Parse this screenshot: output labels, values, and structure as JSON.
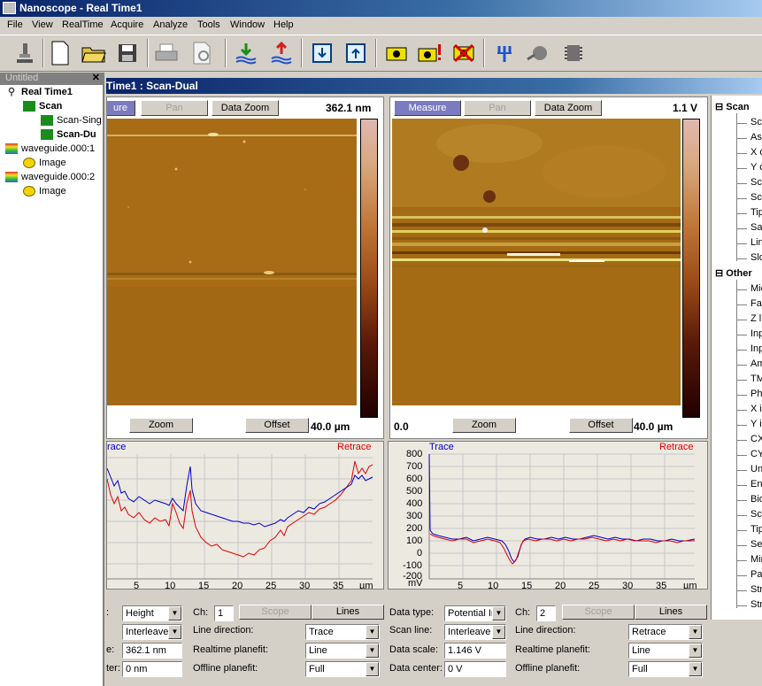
{
  "app": {
    "title": "Nanoscope - Real Time1"
  },
  "menu": [
    "File",
    "View",
    "RealTime",
    "Acquire",
    "Analyze",
    "Tools",
    "Window",
    "Help"
  ],
  "toolbar": {
    "icons": [
      "microscope-icon",
      "new-file-icon",
      "open-folder-icon",
      "save-icon",
      "print-icon",
      "print-preview-icon",
      "engage-icon",
      "withdraw-icon",
      "frame-down-icon",
      "frame-up-icon",
      "capture-icon",
      "capture-now-icon",
      "abort-capture-icon",
      "probe-icon",
      "tip-icon",
      "chip-icon"
    ]
  },
  "tree": {
    "header": "Untitled",
    "close": "✕",
    "nodes": [
      {
        "label": "Real Time1",
        "bold": true,
        "icon": "microscope-icon"
      },
      {
        "label": "Scan",
        "bold": true,
        "icon": "scan-icon"
      },
      {
        "label": "Scan-Sing",
        "bold": false,
        "icon": "scan-icon"
      },
      {
        "label": "Scan-Du",
        "bold": true,
        "icon": "scan-icon"
      },
      {
        "label": "waveguide.000:1",
        "bold": false,
        "icon": "image-file-icon"
      },
      {
        "label": "Image",
        "bold": false,
        "icon": "image-icon"
      },
      {
        "label": "waveguide.000:2",
        "bold": false,
        "icon": "image-file-icon"
      },
      {
        "label": "Image",
        "bold": false,
        "icon": "image-icon"
      }
    ]
  },
  "child": {
    "title": "Time1 : Scan-Dual"
  },
  "left_image": {
    "btn_measure": "ure",
    "btn_pan": "Pan",
    "btn_zoom": "Data Zoom",
    "scale": "362.1 nm",
    "zoom": "Zoom",
    "offset": "Offset",
    "size": "40.0 µm"
  },
  "right_image": {
    "btn_measure": "Measure",
    "btn_pan": "Pan",
    "btn_zoom": "Data Zoom",
    "scale": "1.1 V",
    "origin": "0.0",
    "zoom": "Zoom",
    "offset": "Offset",
    "size": "40.0 µm"
  },
  "left_plot": {
    "trace": "race",
    "retrace": "Retrace",
    "unit": "µm",
    "x_ticks": [
      "5",
      "10",
      "15",
      "20",
      "25",
      "30",
      "35"
    ]
  },
  "right_plot": {
    "trace": "Trace",
    "retrace": "Retrace",
    "unit": "µm",
    "y_unit": "mV",
    "y_ticks": [
      "800",
      "700",
      "600",
      "500",
      "400",
      "300",
      "200",
      "100",
      "0",
      "-100",
      "-200"
    ],
    "x_ticks": [
      "5",
      "10",
      "15",
      "20",
      "25",
      "30",
      "35"
    ]
  },
  "props": {
    "header_scan": "Scan",
    "header_other": "Other",
    "scan_items": [
      "Sca",
      "Asp",
      "X ol",
      "Y ol",
      "Sca",
      "Sca",
      "Tip",
      "San",
      "Line",
      "Slov"
    ],
    "other_items": [
      "Micr",
      "Fas",
      "Z lir",
      "Inp",
      "Inp",
      "Amp",
      "TM",
      "Pha",
      "X in",
      "Y in",
      "CX",
      "CY",
      "Unit",
      "Eng",
      "Bidi",
      "Sca",
      "Tip",
      "Ser",
      "Min",
      "Par",
      "Stri",
      "Stri"
    ],
    "expander": "⊟"
  },
  "left_controls": {
    "row1_lbl": ":",
    "row3_lbl": "e:",
    "row4_lbl": "ter:",
    "data_type": "Height",
    "scan_line": "Interleave",
    "data_scale": "362.1 nm",
    "data_center": "0 nm",
    "ch_label": "Ch:",
    "ch_value": "1",
    "scope": "Scope",
    "lines": "Lines",
    "line_dir_label": "Line direction:",
    "line_dir": "Trace",
    "rt_planefit_label": "Realtime planefit:",
    "rt_planefit": "Line",
    "off_planefit_label": "Offline planefit:",
    "off_planefit": "Full"
  },
  "right_controls": {
    "data_type_label": "Data type:",
    "data_type": "Potential Ir",
    "scan_line_label": "Scan line:",
    "scan_line": "Interleave",
    "data_scale_label": "Data scale:",
    "data_scale": "1.146 V",
    "data_center_label": "Data center:",
    "data_center": "0 V",
    "ch_label": "Ch:",
    "ch_value": "2",
    "scope": "Scope",
    "lines": "Lines",
    "line_dir_label": "Line direction:",
    "line_dir": "Retrace",
    "rt_planefit_label": "Realtime planefit:",
    "rt_planefit": "Line",
    "off_planefit_label": "Offline planefit:",
    "off_planefit": "Full"
  },
  "colors": {
    "trace": "#0000c8",
    "retrace": "#e00000",
    "afm_base": "#a66a14",
    "title_active": "#0a246a"
  }
}
